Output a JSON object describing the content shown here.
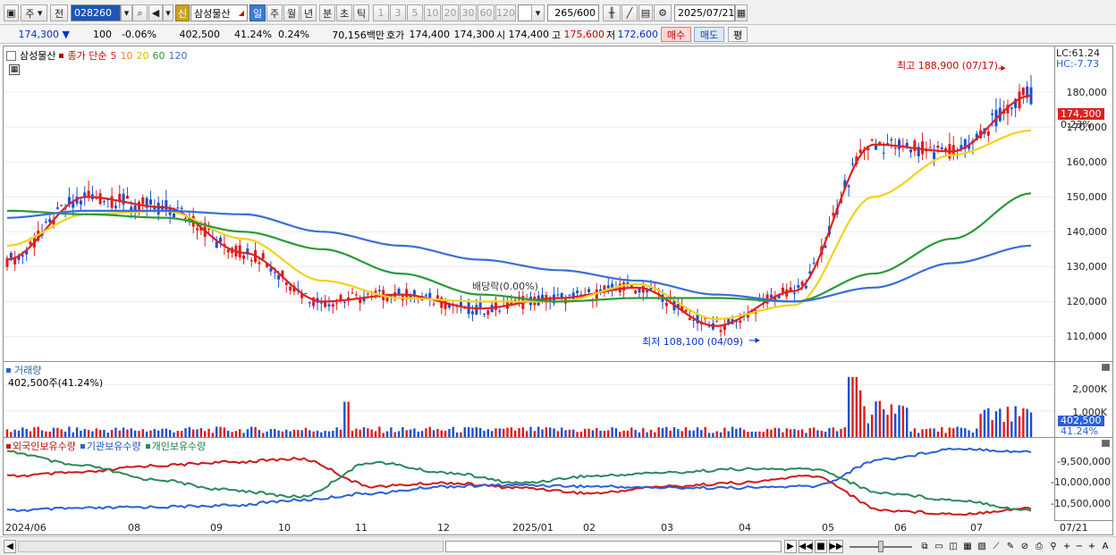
{
  "toolbar": {
    "period_label": "주",
    "prev_label": "전",
    "stock_code": "028260",
    "stock_name": "삼성물산",
    "new_badge": "신",
    "period_buttons": [
      "일",
      "주",
      "월",
      "년",
      "분",
      "초",
      "틱"
    ],
    "active_period": "일",
    "interval_buttons": [
      "1",
      "3",
      "5",
      "10",
      "20",
      "30",
      "60",
      "120"
    ],
    "count_value": "265",
    "count_max": "/600",
    "date_value": "2025/07/21"
  },
  "infobar": {
    "current_price": "174,300",
    "change": "100",
    "change_rate": "-0.06%",
    "volume": "402,500",
    "volume_ratio": "41.24%",
    "turnover_rate": "0.24%",
    "trade_value": "70,156백만",
    "quote_label": "호가",
    "ask": "174,400",
    "bid": "174,300",
    "open_label": "시",
    "open": "174,400",
    "high_label": "고",
    "high": "175,600",
    "low_label": "저",
    "low": "172,600",
    "buy_label": "매수",
    "sell_label": "매도",
    "eval_label": "평"
  },
  "price_pane": {
    "stock_label": "삼성물산",
    "series_label": "종가 단순",
    "ma": [
      {
        "period": "5",
        "color": "#dd2222"
      },
      {
        "period": "10",
        "color": "#f08a1a"
      },
      {
        "period": "20",
        "color": "#f2d21a"
      },
      {
        "period": "60",
        "color": "#2a9a3a"
      },
      {
        "period": "120",
        "color": "#3a6ed8"
      }
    ],
    "max_annotation": "최고 188,900 (07/17)",
    "min_annotation": "최저 108,100 (04/09)",
    "dividend_annotation": "배당락(0.00%)",
    "lc_label": "LC:61.24",
    "hc_label": "HC:-7.73",
    "current_tag": "174,300",
    "current_pct": "0.23%",
    "y_ticks": [
      "180,000",
      "170,000",
      "160,000",
      "150,000",
      "140,000",
      "130,000",
      "120,000",
      "110,000"
    ]
  },
  "volume_pane": {
    "title": "거래량",
    "value_text": "402,500주(41.24%)",
    "y_ticks": [
      "2,000K",
      "1,000K"
    ],
    "current_tag": "402,500",
    "current_pct": "41.24%"
  },
  "holding_pane": {
    "legend": [
      "외국인보유수량",
      "기관보유수량",
      "개인보유수량"
    ],
    "legend_colors": [
      "#d01818",
      "#2a60d8",
      "#2a8a5a"
    ],
    "y_ticks": [
      "-9,500,000",
      "-10,000,000",
      "-10,500,000"
    ]
  },
  "x_axis": [
    "2024/06",
    "08",
    "09",
    "10",
    "11",
    "12",
    "2025/01",
    "02",
    "03",
    "04",
    "05",
    "06",
    "07",
    "07/21"
  ],
  "chart_data": {
    "type": "line",
    "title": "삼성물산 일봉",
    "x": [
      "2024/06",
      "2024/08",
      "2024/09",
      "2024/10",
      "2024/11",
      "2024/12",
      "2025/01",
      "2025/02",
      "2025/03",
      "2025/04",
      "2025/05",
      "2025/06",
      "2025/07",
      "2025/07/21"
    ],
    "series": [
      {
        "name": "종가(5)",
        "values": [
          132000,
          150000,
          147000,
          134000,
          120000,
          122000,
          118000,
          121000,
          124000,
          113000,
          123000,
          165000,
          163000,
          179000
        ]
      },
      {
        "name": "20",
        "values": [
          136000,
          145000,
          146000,
          138000,
          126000,
          121000,
          120000,
          120000,
          125000,
          115000,
          119000,
          150000,
          162000,
          169000
        ]
      },
      {
        "name": "60",
        "values": [
          146000,
          145000,
          144000,
          140000,
          135000,
          128000,
          122000,
          120000,
          121000,
          121000,
          120000,
          128000,
          138000,
          151000
        ]
      },
      {
        "name": "120",
        "values": [
          144000,
          146000,
          146000,
          145000,
          140000,
          136000,
          132000,
          129000,
          126000,
          122000,
          120000,
          124000,
          131000,
          136000
        ]
      }
    ],
    "highlights": {
      "high": 188900,
      "high_date": "07/17",
      "low": 108100,
      "low_date": "04/09",
      "last": 174300
    },
    "ylim": [
      105000,
      190000
    ]
  }
}
